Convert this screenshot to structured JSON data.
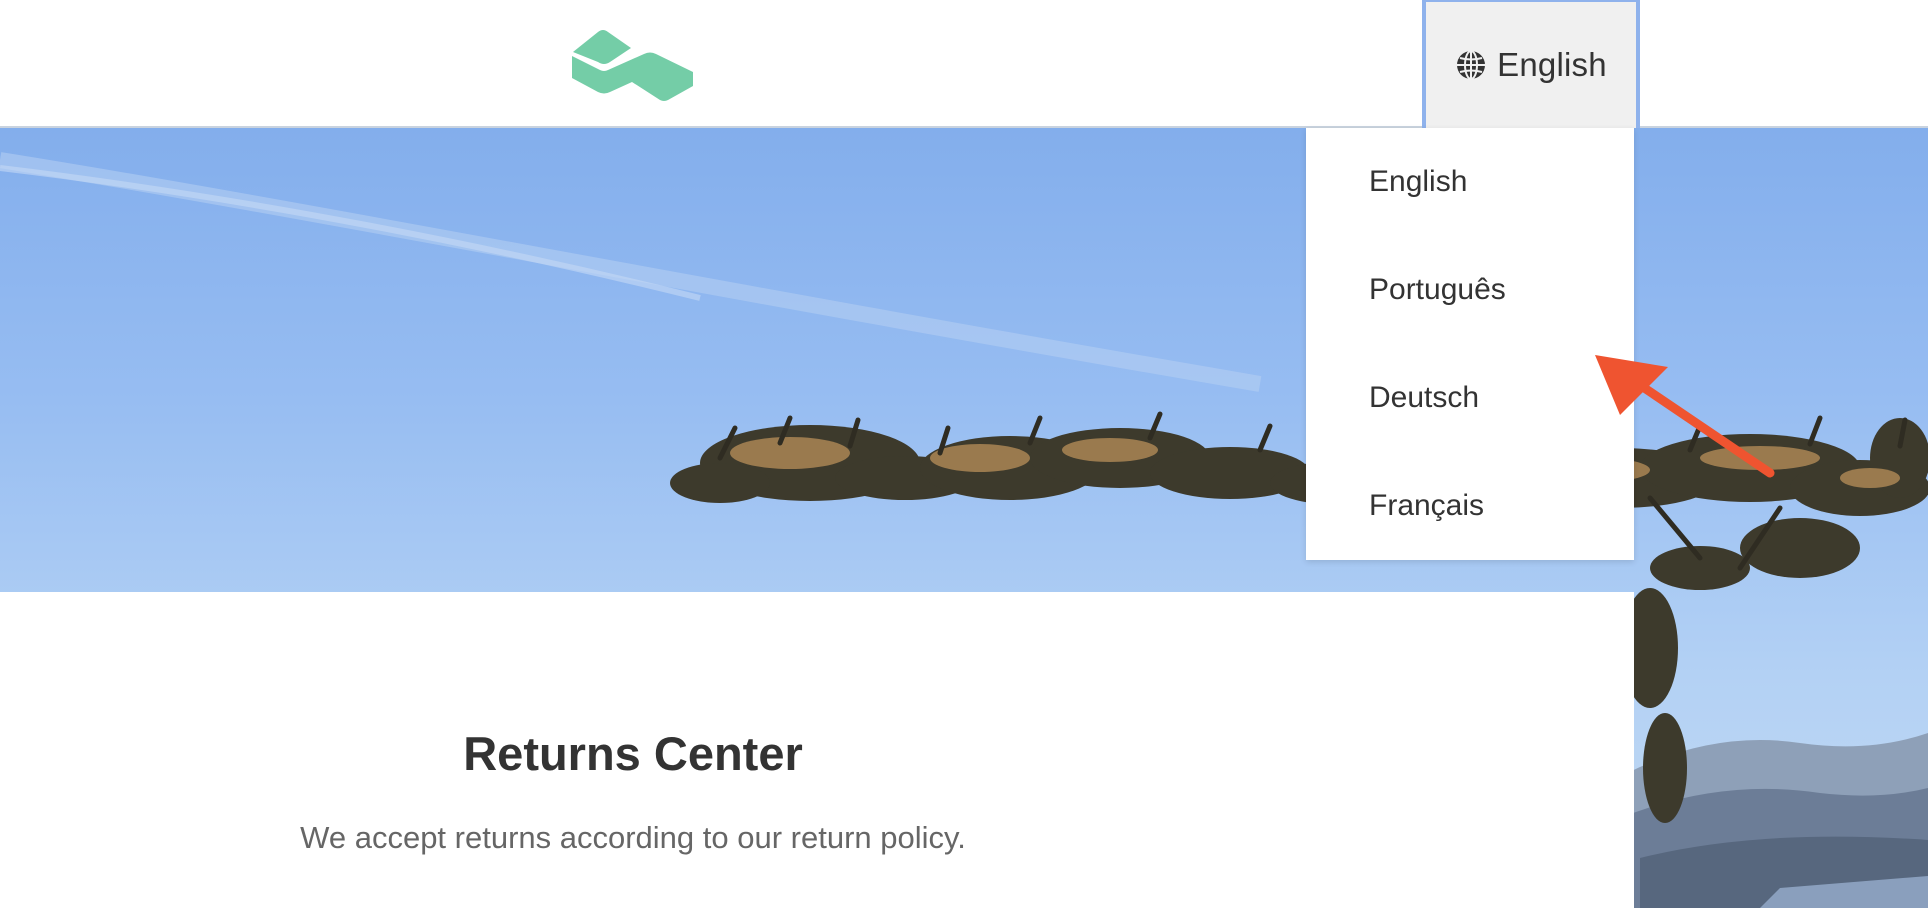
{
  "header": {
    "brand_color": "#74cda7",
    "language_button": {
      "label": "English",
      "icon": "globe-icon"
    }
  },
  "language_menu": {
    "options": [
      "English",
      "Português",
      "Deutsch",
      "Français"
    ]
  },
  "content": {
    "title": "Returns Center",
    "subtitle": "We accept returns according to our return policy."
  },
  "annotation": {
    "arrow_color": "#ef5430"
  }
}
